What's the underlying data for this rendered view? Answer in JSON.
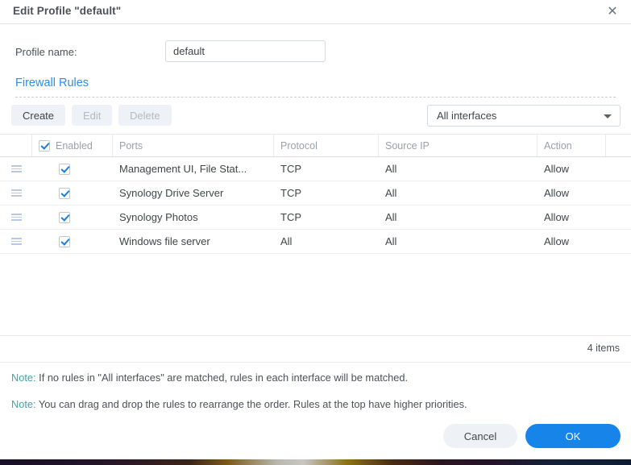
{
  "dialog": {
    "title": "Edit Profile \"default\"",
    "close_icon": "close-icon"
  },
  "profile": {
    "label": "Profile name:",
    "value": "default",
    "placeholder": ""
  },
  "section": {
    "heading": "Firewall Rules"
  },
  "toolbar": {
    "create_label": "Create",
    "edit_label": "Edit",
    "delete_label": "Delete",
    "interface_select": {
      "value": "All interfaces",
      "caret_icon": "chevron-down-icon"
    }
  },
  "grid": {
    "columns": [
      {
        "key": "handle",
        "label": ""
      },
      {
        "key": "enabled",
        "label": "Enabled"
      },
      {
        "key": "ports",
        "label": "Ports"
      },
      {
        "key": "protocol",
        "label": "Protocol"
      },
      {
        "key": "source_ip",
        "label": "Source IP"
      },
      {
        "key": "action",
        "label": "Action"
      },
      {
        "key": "tail",
        "label": ""
      }
    ],
    "header_checkbox_checked": true,
    "rows": [
      {
        "enabled": true,
        "ports": "Management UI, File Stat...",
        "protocol": "TCP",
        "source_ip": "All",
        "action": "Allow"
      },
      {
        "enabled": true,
        "ports": "Synology Drive Server",
        "protocol": "TCP",
        "source_ip": "All",
        "action": "Allow"
      },
      {
        "enabled": true,
        "ports": "Synology Photos",
        "protocol": "TCP",
        "source_ip": "All",
        "action": "Allow"
      },
      {
        "enabled": true,
        "ports": "Windows file server",
        "protocol": "All",
        "source_ip": "All",
        "action": "Allow"
      }
    ],
    "items_count": "4 items"
  },
  "notes": [
    {
      "label": "Note:",
      "text": " If no rules in \"All interfaces\" are matched, rules in each interface will be matched."
    },
    {
      "label": "Note:",
      "text": " You can drag and drop the rules to rearrange the order. Rules at the top have higher priorities."
    }
  ],
  "footer": {
    "cancel_label": "Cancel",
    "ok_label": "OK"
  },
  "colors": {
    "accent": "#1684e8",
    "link": "#2f8ce8",
    "note_label": "#3aa7ab",
    "checkbox": "#1a7ee0"
  }
}
